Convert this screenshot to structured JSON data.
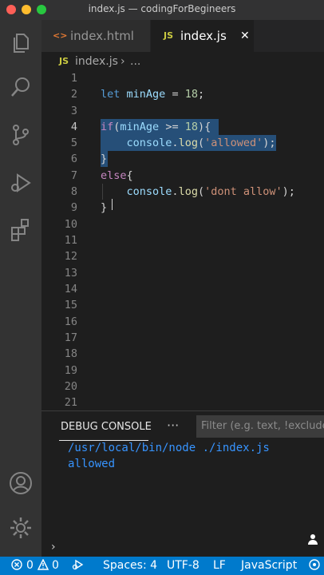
{
  "window": {
    "title": "index.js — codingForBegineers"
  },
  "activity_bar": [
    "files-icon",
    "search-icon",
    "source-control-icon",
    "run-debug-icon",
    "extensions-icon",
    "account-icon",
    "settings-gear-icon"
  ],
  "tabs": [
    {
      "icon": "<>",
      "label": "index.html",
      "active": false
    },
    {
      "icon": "JS",
      "label": "index.js",
      "active": true,
      "close": "✕"
    }
  ],
  "breadcrumb": {
    "icon": "JS",
    "file": "index.js",
    "sep": "›",
    "rest": "..."
  },
  "editor": {
    "line_numbers": [
      "1",
      "2",
      "3",
      "4",
      "5",
      "6",
      "7",
      "8",
      "9",
      "10",
      "11",
      "12",
      "13",
      "14",
      "15",
      "16",
      "17",
      "18",
      "19",
      "20",
      "21"
    ],
    "code": {
      "l2": {
        "kw": "let",
        "sp1": " ",
        "var": "minAge",
        "rest": " = ",
        "num": "18",
        "end": ";"
      },
      "l4": {
        "kw": "if",
        "open": "(",
        "var": "minAge",
        "op": " >= ",
        "num": "18",
        "close": "){"
      },
      "l5": {
        "indent": "    ",
        "obj": "console",
        "dot": ".",
        "fn": "log",
        "open": "(",
        "str": "'allowed'",
        "close": ");"
      },
      "l6": {
        "text": "}"
      },
      "l7": {
        "kw": "else",
        "brace": "{"
      },
      "l8": {
        "indent": "    ",
        "obj": "console",
        "dot": ".",
        "fn": "log",
        "open": "(",
        "str": "'dont allow'",
        "close": ");"
      },
      "l9": {
        "text": "}"
      }
    }
  },
  "panel": {
    "title": "DEBUG CONSOLE",
    "more": "···",
    "filter_placeholder": "Filter (e.g. text, !exclude)",
    "output": [
      "/usr/local/bin/node ./index.js",
      "allowed"
    ],
    "prompt": "›"
  },
  "statusbar": {
    "errors": "0",
    "warnings": "0",
    "spaces": "Spaces: 4",
    "encoding": "UTF-8",
    "eol": "LF",
    "language": "JavaScript"
  },
  "colors": {
    "accent": "#007acc",
    "selection": "#264f78",
    "keyword": "#569cd6",
    "control": "#c586c0",
    "string": "#ce9178"
  }
}
